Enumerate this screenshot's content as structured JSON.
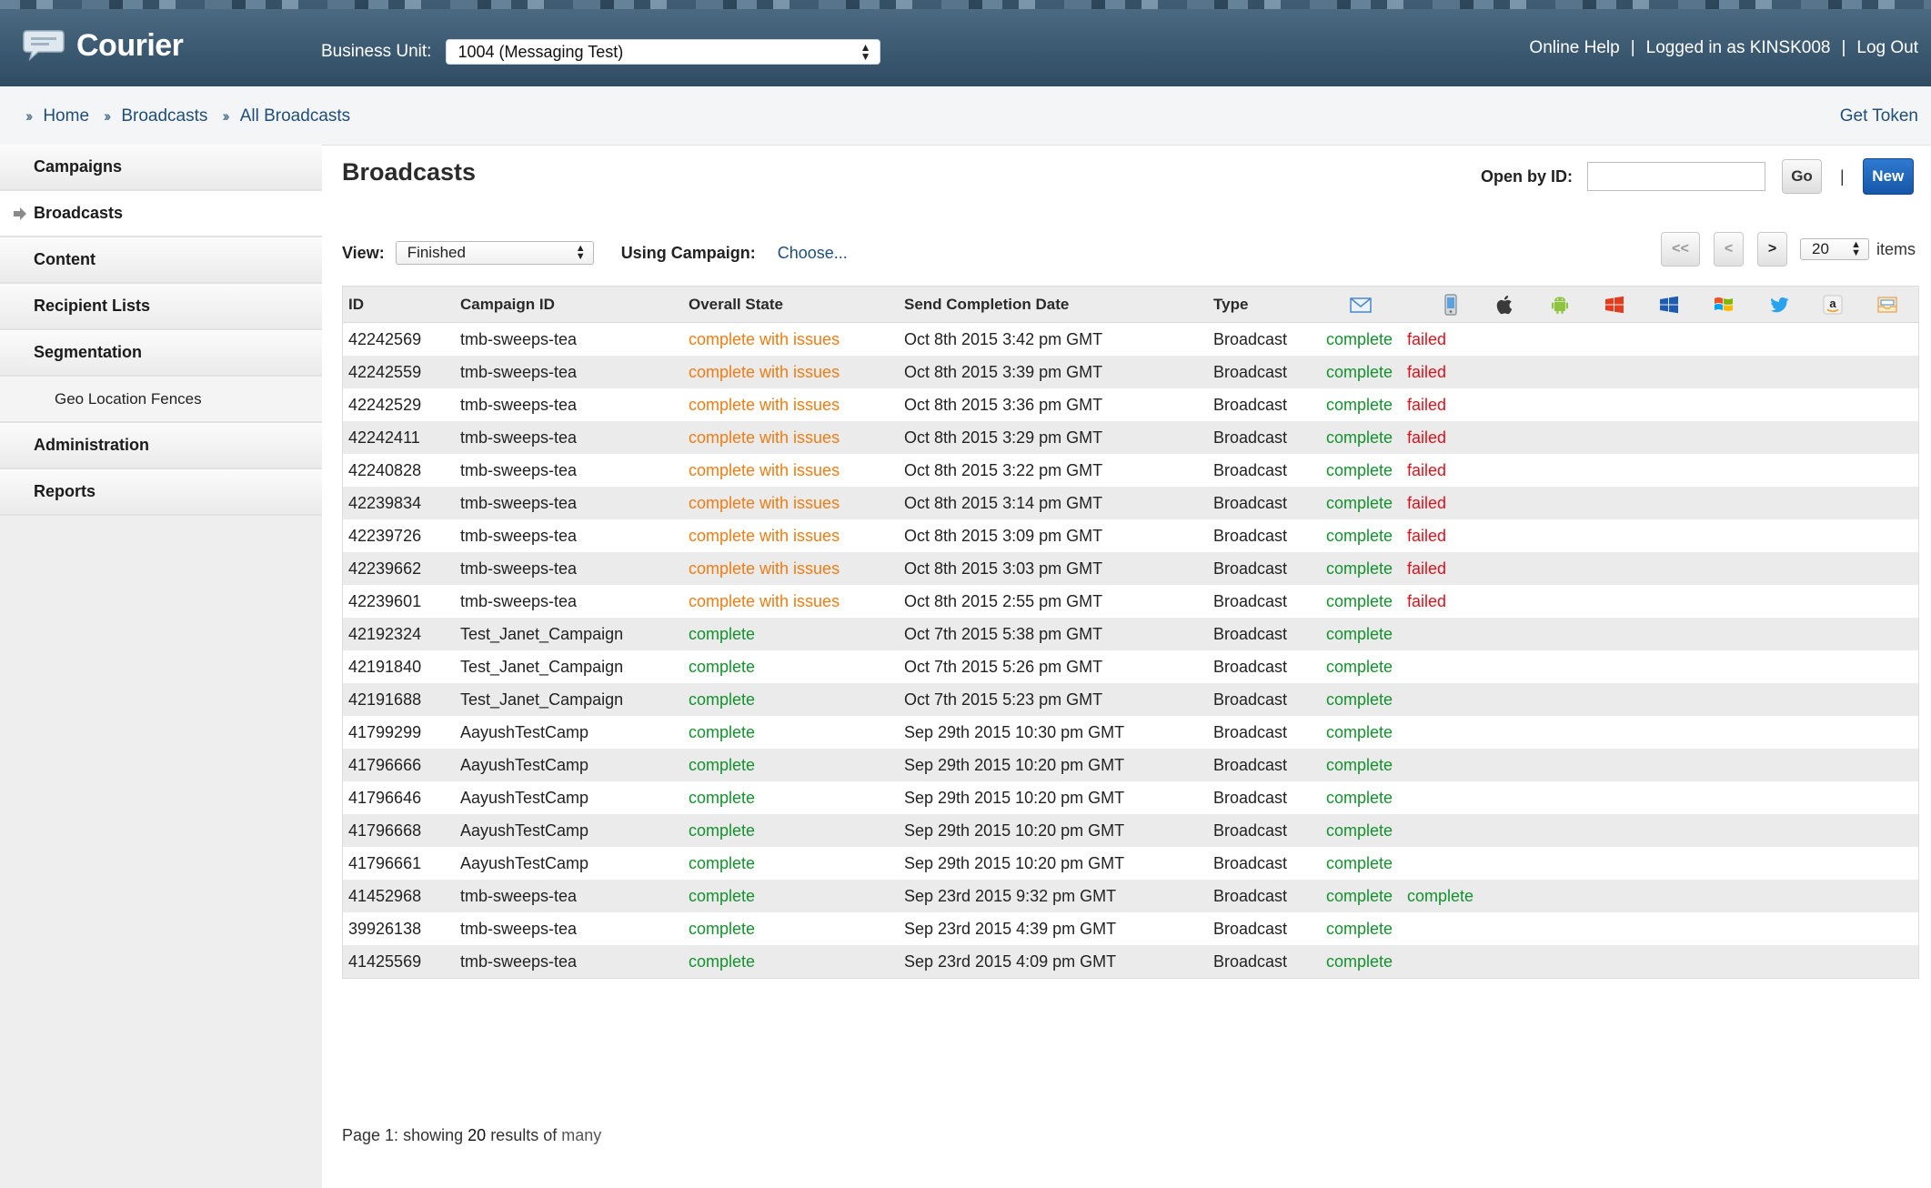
{
  "app": {
    "name": "Courier",
    "business_unit_label": "Business Unit:",
    "business_unit_value": "1004 (Messaging Test)",
    "online_help": "Online Help",
    "logged_in": "Logged in as KINSK008",
    "log_out": "Log Out",
    "separator": "|"
  },
  "breadcrumb": [
    "Home",
    "Broadcasts",
    "All Broadcasts"
  ],
  "get_token": "Get Token",
  "sidebar": {
    "items": [
      {
        "label": "Campaigns",
        "active": false
      },
      {
        "label": "Broadcasts",
        "active": true
      },
      {
        "label": "Content",
        "active": false
      },
      {
        "label": "Recipient Lists",
        "active": false
      },
      {
        "label": "Segmentation",
        "active": false
      },
      {
        "label": "Geo Location Fences",
        "active": false,
        "sub": true
      },
      {
        "label": "Administration",
        "active": false
      },
      {
        "label": "Reports",
        "active": false
      }
    ]
  },
  "main": {
    "title": "Broadcasts",
    "open_by_id_label": "Open by ID:",
    "open_by_id_value": "",
    "go_label": "Go",
    "new_label": "New",
    "view_label": "View:",
    "view_value": "Finished",
    "using_campaign_label": "Using Campaign:",
    "choose_label": "Choose...",
    "pager": {
      "first": "<<",
      "prev": "<",
      "next": ">",
      "page_size": "20",
      "items_label": "items"
    }
  },
  "table": {
    "headers": {
      "id": "ID",
      "campaign": "Campaign ID",
      "state": "Overall State",
      "date": "Send Completion Date",
      "type": "Type"
    },
    "channel_icons": [
      "email-icon",
      "sms-phone-icon",
      "apple-icon",
      "android-icon",
      "windows-8-icon",
      "windows-phone-icon",
      "windows-legacy-icon",
      "twitter-icon",
      "amazon-icon",
      "inbox-icon"
    ],
    "rows": [
      {
        "id": "42242569",
        "campaign": "tmb-sweeps-tea",
        "state": "complete with issues",
        "date": "Oct 8th 2015 3:42 pm GMT",
        "type": "Broadcast",
        "email": "complete",
        "sms": "failed"
      },
      {
        "id": "42242559",
        "campaign": "tmb-sweeps-tea",
        "state": "complete with issues",
        "date": "Oct 8th 2015 3:39 pm GMT",
        "type": "Broadcast",
        "email": "complete",
        "sms": "failed"
      },
      {
        "id": "42242529",
        "campaign": "tmb-sweeps-tea",
        "state": "complete with issues",
        "date": "Oct 8th 2015 3:36 pm GMT",
        "type": "Broadcast",
        "email": "complete",
        "sms": "failed"
      },
      {
        "id": "42242411",
        "campaign": "tmb-sweeps-tea",
        "state": "complete with issues",
        "date": "Oct 8th 2015 3:29 pm GMT",
        "type": "Broadcast",
        "email": "complete",
        "sms": "failed"
      },
      {
        "id": "42240828",
        "campaign": "tmb-sweeps-tea",
        "state": "complete with issues",
        "date": "Oct 8th 2015 3:22 pm GMT",
        "type": "Broadcast",
        "email": "complete",
        "sms": "failed"
      },
      {
        "id": "42239834",
        "campaign": "tmb-sweeps-tea",
        "state": "complete with issues",
        "date": "Oct 8th 2015 3:14 pm GMT",
        "type": "Broadcast",
        "email": "complete",
        "sms": "failed"
      },
      {
        "id": "42239726",
        "campaign": "tmb-sweeps-tea",
        "state": "complete with issues",
        "date": "Oct 8th 2015 3:09 pm GMT",
        "type": "Broadcast",
        "email": "complete",
        "sms": "failed"
      },
      {
        "id": "42239662",
        "campaign": "tmb-sweeps-tea",
        "state": "complete with issues",
        "date": "Oct 8th 2015 3:03 pm GMT",
        "type": "Broadcast",
        "email": "complete",
        "sms": "failed"
      },
      {
        "id": "42239601",
        "campaign": "tmb-sweeps-tea",
        "state": "complete with issues",
        "date": "Oct 8th 2015 2:55 pm GMT",
        "type": "Broadcast",
        "email": "complete",
        "sms": "failed"
      },
      {
        "id": "42192324",
        "campaign": "Test_Janet_Campaign",
        "state": "complete",
        "date": "Oct 7th 2015 5:38 pm GMT",
        "type": "Broadcast",
        "email": "complete",
        "sms": ""
      },
      {
        "id": "42191840",
        "campaign": "Test_Janet_Campaign",
        "state": "complete",
        "date": "Oct 7th 2015 5:26 pm GMT",
        "type": "Broadcast",
        "email": "complete",
        "sms": ""
      },
      {
        "id": "42191688",
        "campaign": "Test_Janet_Campaign",
        "state": "complete",
        "date": "Oct 7th 2015 5:23 pm GMT",
        "type": "Broadcast",
        "email": "complete",
        "sms": ""
      },
      {
        "id": "41799299",
        "campaign": "AayushTestCamp",
        "state": "complete",
        "date": "Sep 29th 2015 10:30 pm GMT",
        "type": "Broadcast",
        "email": "complete",
        "sms": ""
      },
      {
        "id": "41796666",
        "campaign": "AayushTestCamp",
        "state": "complete",
        "date": "Sep 29th 2015 10:20 pm GMT",
        "type": "Broadcast",
        "email": "complete",
        "sms": ""
      },
      {
        "id": "41796646",
        "campaign": "AayushTestCamp",
        "state": "complete",
        "date": "Sep 29th 2015 10:20 pm GMT",
        "type": "Broadcast",
        "email": "complete",
        "sms": ""
      },
      {
        "id": "41796668",
        "campaign": "AayushTestCamp",
        "state": "complete",
        "date": "Sep 29th 2015 10:20 pm GMT",
        "type": "Broadcast",
        "email": "complete",
        "sms": ""
      },
      {
        "id": "41796661",
        "campaign": "AayushTestCamp",
        "state": "complete",
        "date": "Sep 29th 2015 10:20 pm GMT",
        "type": "Broadcast",
        "email": "complete",
        "sms": ""
      },
      {
        "id": "41452968",
        "campaign": "tmb-sweeps-tea",
        "state": "complete",
        "date": "Sep 23rd 2015 9:32 pm GMT",
        "type": "Broadcast",
        "email": "complete",
        "sms": "complete"
      },
      {
        "id": "39926138",
        "campaign": "tmb-sweeps-tea",
        "state": "complete",
        "date": "Sep 23rd 2015 4:39 pm GMT",
        "type": "Broadcast",
        "email": "complete",
        "sms": ""
      },
      {
        "id": "41425569",
        "campaign": "tmb-sweeps-tea",
        "state": "complete",
        "date": "Sep 23rd 2015 4:09 pm GMT",
        "type": "Broadcast",
        "email": "complete",
        "sms": ""
      }
    ]
  },
  "footer": {
    "page": "Page 1:",
    "showing": "showing",
    "count": "20",
    "results_of": "results of",
    "many": "many"
  },
  "colors": {
    "issue": "#f07c13",
    "complete": "#12922c",
    "failed": "#e0101b",
    "link": "#1f4e79",
    "header_bg": "#3c5a72"
  }
}
